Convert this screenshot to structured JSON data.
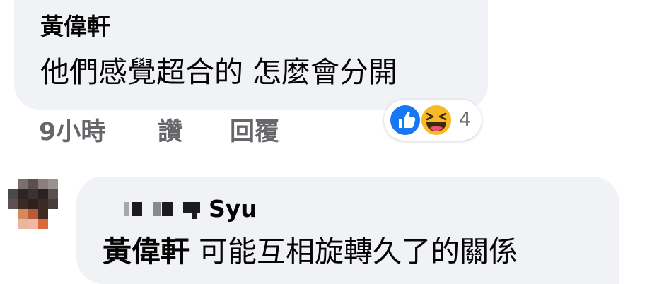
{
  "comment1": {
    "author": "黃偉軒",
    "text": "他們感覺超合的 怎麼會分開",
    "time": "9小時",
    "like_label": "讚",
    "reply_label": "回覆",
    "reactions": {
      "icons": [
        "like-icon",
        "haha-icon"
      ],
      "count": "4",
      "like_color": "#1877f2",
      "haha_color": "#f7b928"
    }
  },
  "comment2": {
    "author_suffix": "Syu",
    "mention": "黃偉軒",
    "text": "可能互相旋轉久了的關係"
  },
  "colors": {
    "bubble": "#f0f2f5",
    "text": "#050505",
    "secondary": "#65676b"
  }
}
